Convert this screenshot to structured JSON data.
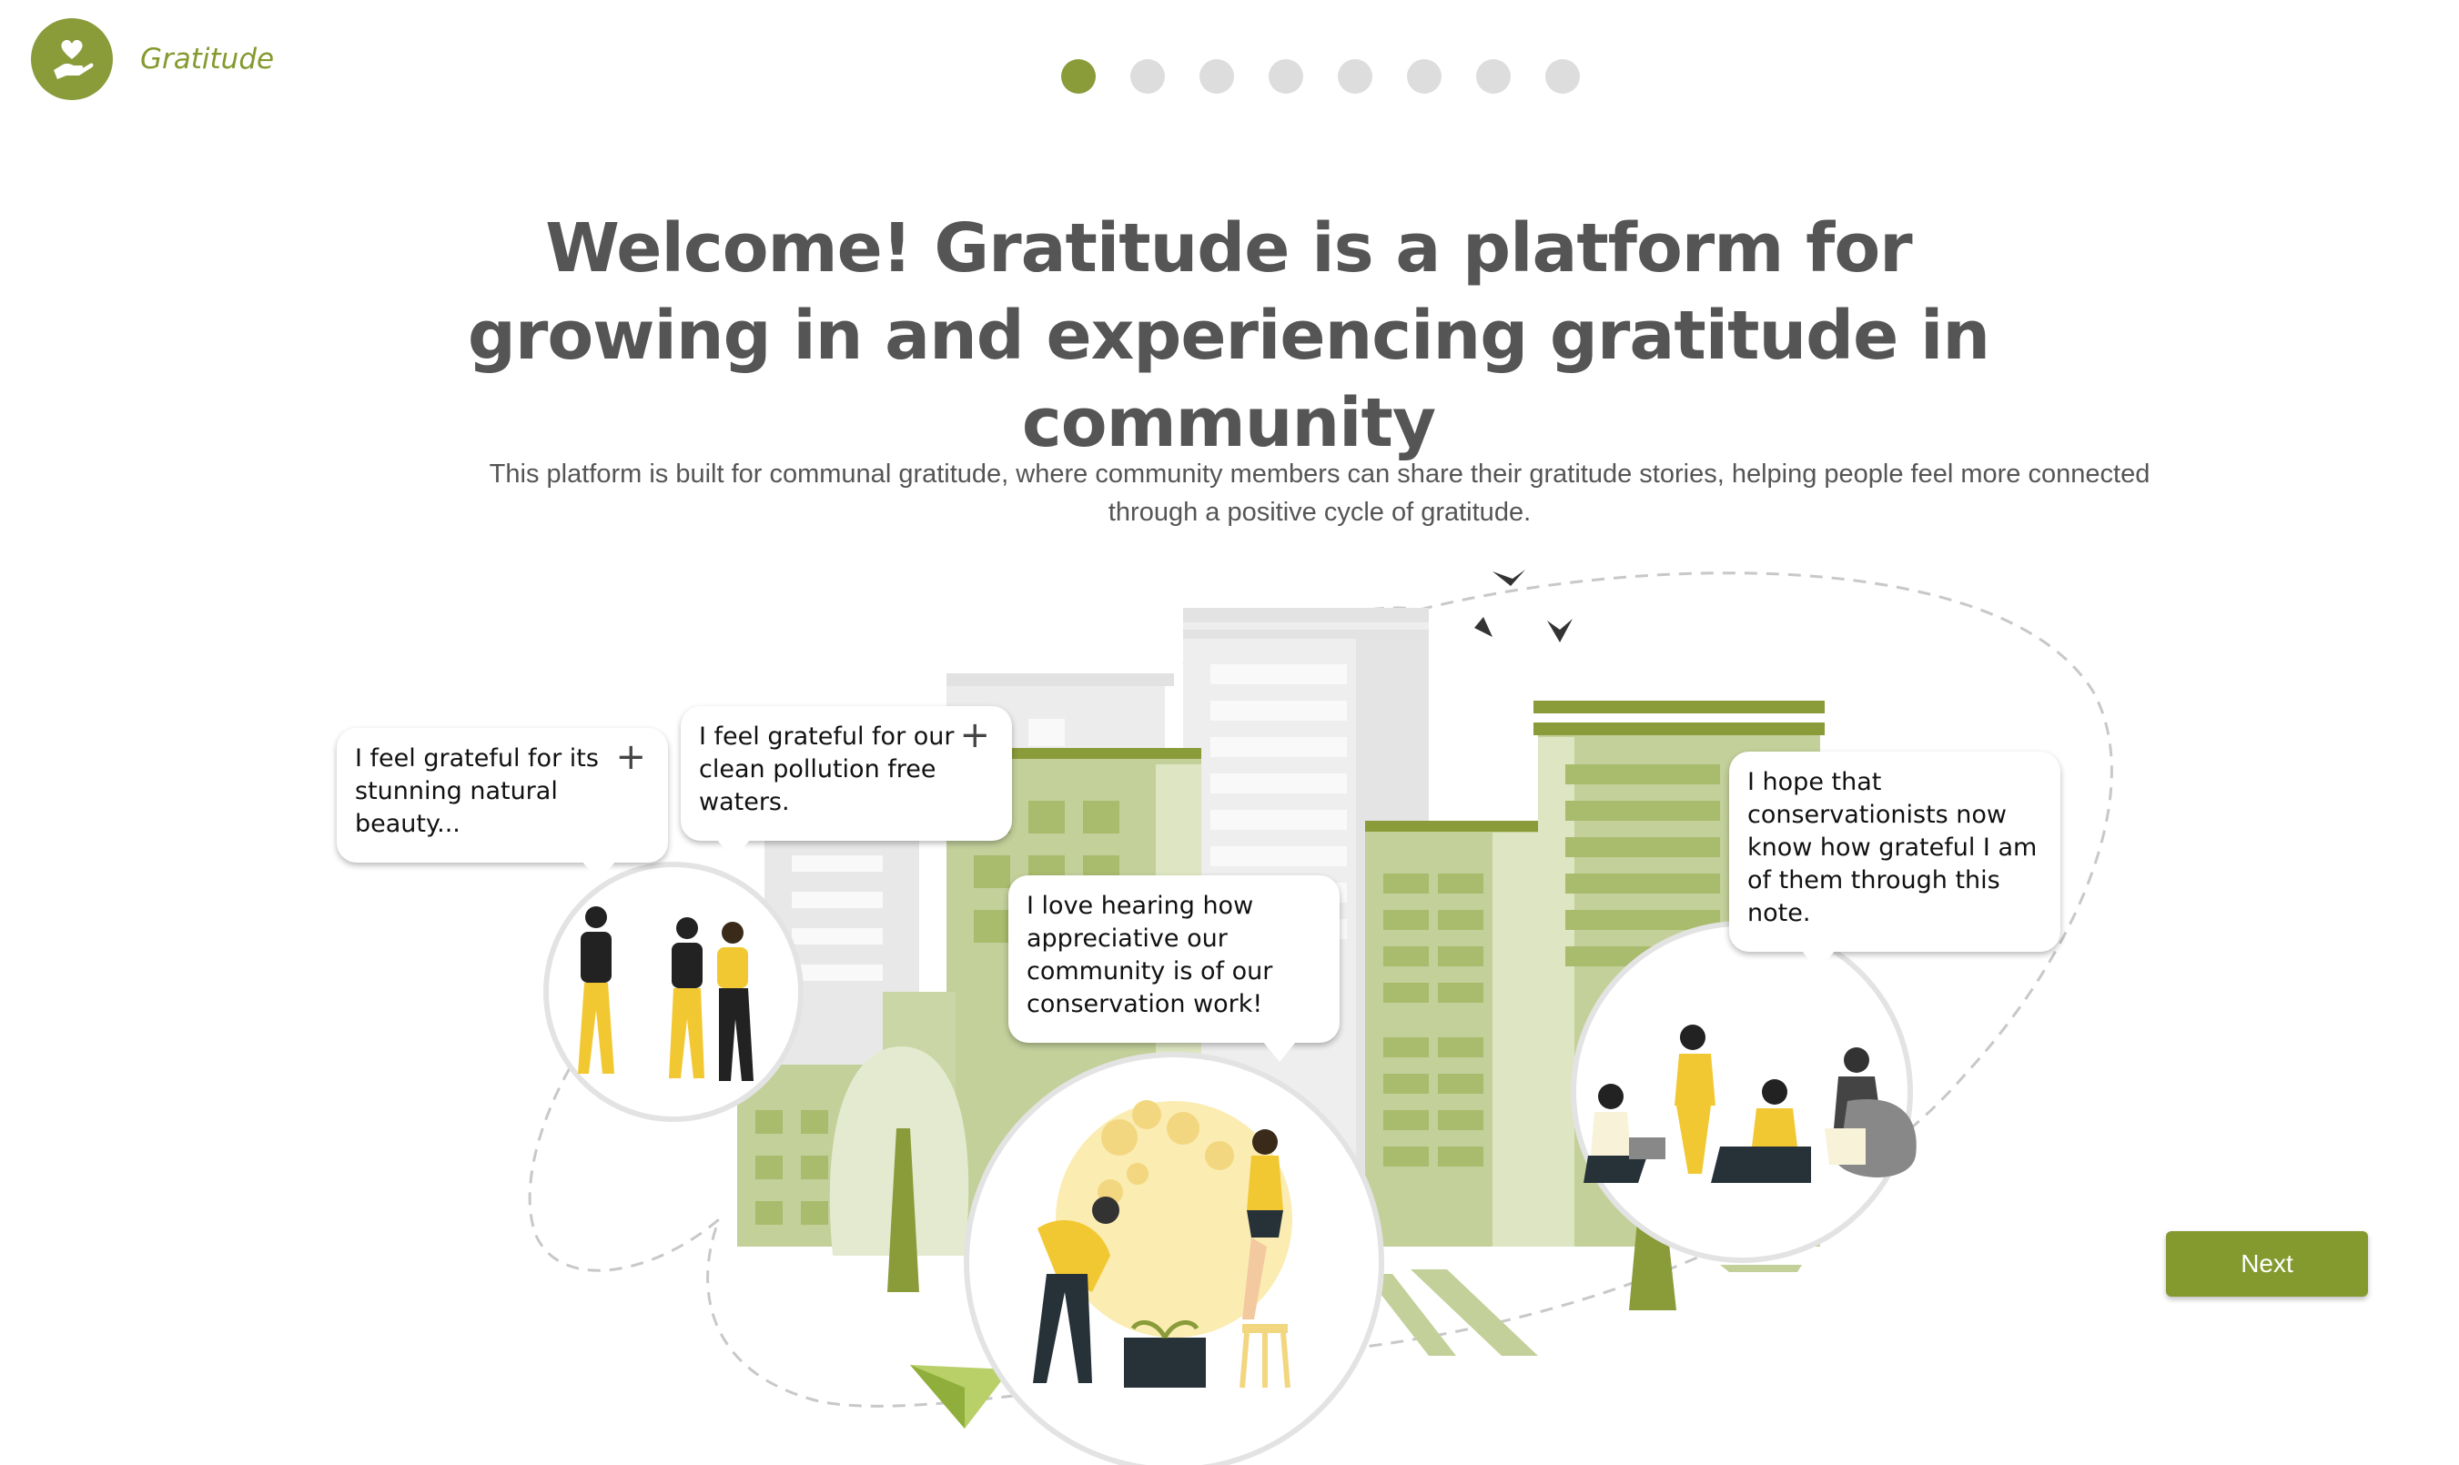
{
  "app": {
    "name": "Gratitude",
    "brand_color": "#849a2f"
  },
  "stepper": {
    "total_steps": 8,
    "current_step": 1
  },
  "hero": {
    "title": "Welcome! Gratitude is a platform for growing in and experiencing gratitude in community",
    "subtitle": "This platform is built for communal gratitude, where community members can share their gratitude stories, helping people feel more connected through a positive cycle of gratitude."
  },
  "bubbles": [
    {
      "text": "I feel grateful for its stunning natural beauty...",
      "has_plus": true
    },
    {
      "text": "I feel grateful for our clean pollution free waters.",
      "has_plus": true
    },
    {
      "text": "I love hearing how appreciative our community is of our conservation work!",
      "has_plus": false
    },
    {
      "text": "I hope that conservationists now know how grateful I am of them through this note.",
      "has_plus": false
    }
  ],
  "actions": {
    "next_label": "Next"
  },
  "icons": {
    "logo": "heart-hand-icon",
    "add": "plus-icon"
  },
  "colors": {
    "accent": "#849a2f",
    "building_green": "#c3d09a",
    "building_dark": "#8a9b3a",
    "building_grey": "#e6e6e6",
    "figure_yellow": "#f2c832",
    "inactive_dot": "#dddddd"
  }
}
